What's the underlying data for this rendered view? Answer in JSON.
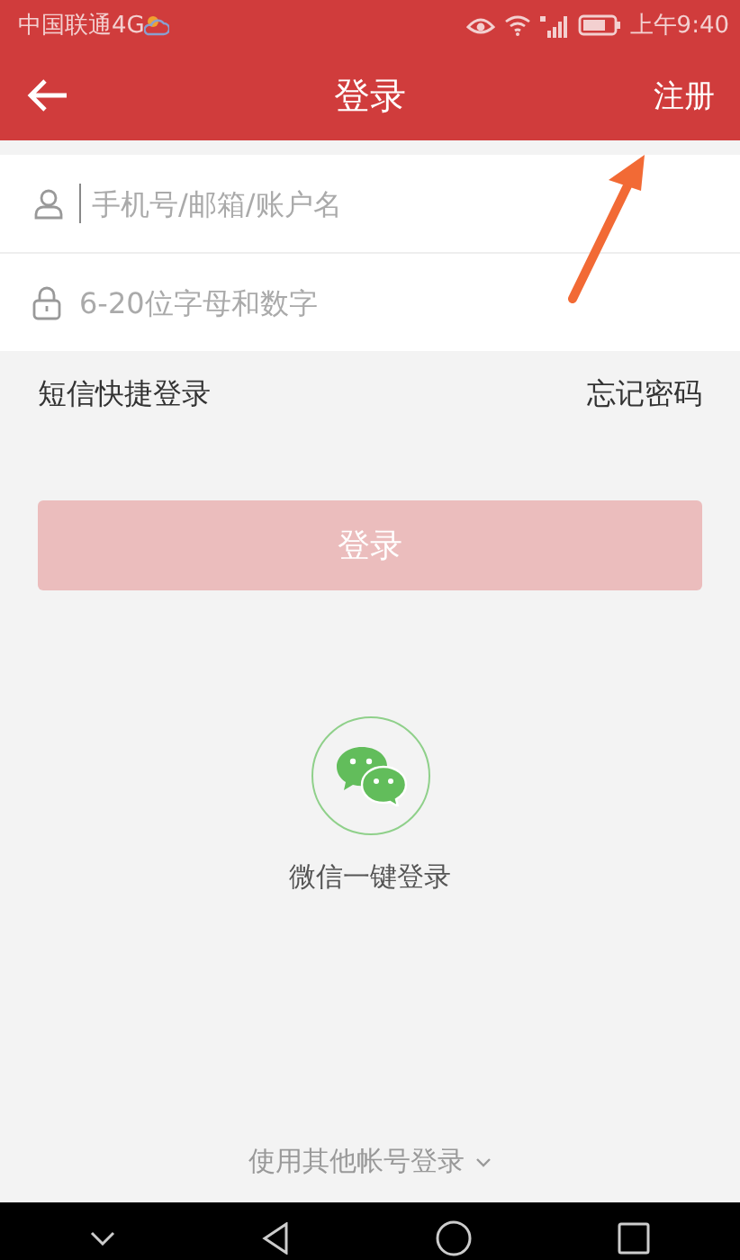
{
  "status_bar": {
    "carrier": "中国联通4G",
    "time": "上午9:40"
  },
  "app_bar": {
    "title": "登录",
    "action": "注册"
  },
  "fields": [
    {
      "kind": "user",
      "placeholder": "手机号/邮箱/账户名",
      "focused": true
    },
    {
      "kind": "lock",
      "placeholder": "6-20位字母和数字",
      "focused": false
    }
  ],
  "links": {
    "sms_login": "短信快捷登录",
    "forgot_password": "忘记密码"
  },
  "login_button": {
    "label": "登录",
    "disabled": true
  },
  "wechat_login": {
    "label": "微信一键登录"
  },
  "other_accounts": {
    "label": "使用其他帐号登录"
  },
  "annotation": {
    "kind": "arrow"
  }
}
